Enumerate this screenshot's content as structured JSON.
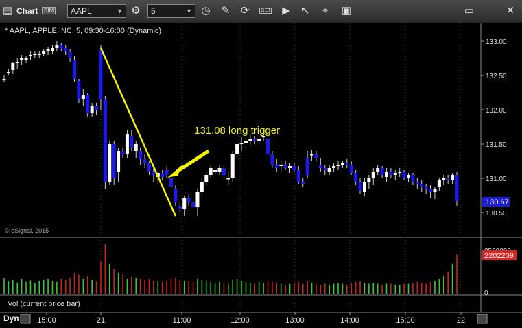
{
  "toolbar": {
    "title": "Chart",
    "sim_badge": "SIM",
    "symbol": "AAPL",
    "interval": "5",
    "icons": [
      "app-logo-icon",
      "sim-icon",
      "symbol-dropdown-icon",
      "refresh-icon",
      "interval-dropdown-icon",
      "clock-icon",
      "draw-pencil-icon",
      "link-icon",
      "get-icon",
      "play-icon",
      "pointer-icon",
      "tool-icon",
      "window-icon",
      "minimize-icon",
      "close-icon"
    ],
    "get_label": "GET"
  },
  "header": "* AAPL, APPLE INC, 5, 09:30-16:00 (Dynamic)",
  "watermark": "© eSignal, 2015",
  "annotation": "131.08 long trigger",
  "vol_label": "Vol (current price bar)",
  "dyn_label": "Dyn",
  "colors": {
    "up": "#ffffff",
    "down": "#1a1aee",
    "trend": "#f5f500",
    "vol_up": "#33cc33",
    "vol_down": "#cc2222",
    "price_badge": "#1c1cdd",
    "vol_badge": "#dd2222"
  },
  "chart_data": {
    "type": "candlestick",
    "price_axis": {
      "ticks": [
        "133.00",
        "132.50",
        "132.00",
        "131.50",
        "131.00",
        "130.50"
      ],
      "ylim": [
        130.35,
        133.2
      ]
    },
    "last_price": "130.67",
    "volume_axis": {
      "ticks": [
        "2500000",
        "0"
      ]
    },
    "last_volume": "2202209",
    "time_axis": {
      "ticks": [
        "15:00",
        "21",
        "11:00",
        "12:00",
        "13:00",
        "14:00",
        "15:00",
        "22"
      ]
    },
    "candles": [
      [
        132.45,
        132.5,
        132.4,
        132.45
      ],
      [
        132.55,
        132.6,
        132.5,
        132.55
      ],
      [
        132.58,
        132.7,
        132.52,
        132.68
      ],
      [
        132.68,
        132.75,
        132.6,
        132.7
      ],
      [
        132.72,
        132.8,
        132.66,
        132.75
      ],
      [
        132.72,
        132.78,
        132.68,
        132.75
      ],
      [
        132.78,
        132.85,
        132.72,
        132.8
      ],
      [
        132.8,
        132.86,
        132.75,
        132.82
      ],
      [
        132.8,
        132.86,
        132.75,
        132.82
      ],
      [
        132.82,
        132.88,
        132.78,
        132.85
      ],
      [
        132.85,
        132.92,
        132.8,
        132.88
      ],
      [
        132.86,
        132.95,
        132.82,
        132.9
      ],
      [
        132.9,
        133.0,
        132.85,
        132.95
      ],
      [
        132.95,
        132.98,
        132.85,
        132.88
      ],
      [
        132.9,
        132.95,
        132.8,
        132.85
      ],
      [
        132.85,
        132.88,
        132.7,
        132.75
      ],
      [
        132.72,
        132.78,
        132.4,
        132.45
      ],
      [
        132.42,
        132.45,
        132.1,
        132.15
      ],
      [
        132.15,
        132.3,
        132.05,
        132.22
      ],
      [
        132.22,
        132.25,
        131.9,
        131.95
      ],
      [
        131.95,
        132.1,
        131.9,
        132.05
      ],
      [
        132.05,
        132.1,
        131.92,
        132.0
      ],
      [
        132.88,
        132.95,
        132.0,
        132.15
      ],
      [
        132.15,
        132.2,
        130.85,
        130.95
      ],
      [
        130.95,
        131.55,
        130.9,
        131.5
      ],
      [
        131.5,
        131.55,
        130.9,
        131.0
      ],
      [
        131.1,
        131.45,
        130.95,
        131.4
      ],
      [
        131.4,
        131.45,
        131.3,
        131.35
      ],
      [
        131.35,
        131.7,
        131.3,
        131.65
      ],
      [
        131.62,
        131.7,
        131.4,
        131.45
      ],
      [
        131.4,
        131.55,
        131.3,
        131.5
      ],
      [
        131.4,
        131.45,
        131.2,
        131.28
      ],
      [
        131.28,
        131.35,
        131.15,
        131.22
      ],
      [
        131.22,
        131.25,
        131.05,
        131.1
      ],
      [
        131.1,
        131.15,
        130.95,
        131.05
      ],
      [
        131.02,
        131.1,
        130.92,
        131.08
      ],
      [
        131.08,
        131.12,
        130.98,
        131.02
      ],
      [
        131.12,
        131.18,
        131.0,
        131.05
      ],
      [
        131.0,
        131.05,
        130.85,
        130.88
      ],
      [
        130.85,
        130.9,
        130.6,
        130.65
      ],
      [
        130.6,
        130.65,
        130.5,
        130.55
      ],
      [
        130.55,
        130.75,
        130.45,
        130.72
      ],
      [
        130.72,
        130.78,
        130.6,
        130.65
      ],
      [
        130.65,
        130.7,
        130.55,
        130.58
      ],
      [
        130.58,
        130.85,
        130.45,
        130.8
      ],
      [
        130.8,
        131.0,
        130.75,
        130.95
      ],
      [
        130.95,
        131.1,
        130.9,
        131.05
      ],
      [
        131.05,
        131.2,
        131.0,
        131.15
      ],
      [
        131.1,
        131.18,
        131.05,
        131.12
      ],
      [
        131.1,
        131.2,
        131.05,
        131.15
      ],
      [
        131.15,
        131.2,
        131.0,
        131.05
      ],
      [
        131.0,
        131.1,
        130.9,
        131.0
      ],
      [
        131.0,
        131.4,
        130.95,
        131.35
      ],
      [
        131.35,
        131.55,
        131.3,
        131.5
      ],
      [
        131.5,
        131.6,
        131.4,
        131.52
      ],
      [
        131.52,
        131.6,
        131.45,
        131.55
      ],
      [
        131.55,
        131.65,
        131.48,
        131.58
      ],
      [
        131.58,
        131.62,
        131.5,
        131.55
      ],
      [
        131.55,
        131.62,
        131.48,
        131.58
      ],
      [
        131.6,
        131.65,
        131.55,
        131.62
      ],
      [
        131.58,
        131.62,
        131.3,
        131.35
      ],
      [
        131.35,
        131.4,
        131.15,
        131.2
      ],
      [
        131.2,
        131.28,
        131.1,
        131.15
      ],
      [
        131.18,
        131.25,
        131.1,
        131.2
      ],
      [
        131.2,
        131.25,
        131.12,
        131.15
      ],
      [
        131.15,
        131.22,
        131.08,
        131.18
      ],
      [
        131.18,
        131.22,
        131.1,
        131.12
      ],
      [
        131.12,
        131.18,
        130.92,
        130.95
      ],
      [
        130.95,
        131.0,
        130.88,
        130.92
      ],
      [
        131.3,
        131.4,
        131.0,
        131.05
      ],
      [
        131.35,
        131.42,
        131.25,
        131.35
      ],
      [
        131.35,
        131.4,
        131.25,
        131.3
      ],
      [
        131.2,
        131.3,
        131.1,
        131.15
      ],
      [
        131.15,
        131.2,
        131.05,
        131.12
      ],
      [
        131.1,
        131.2,
        131.05,
        131.15
      ],
      [
        131.15,
        131.22,
        131.1,
        131.18
      ],
      [
        131.18,
        131.25,
        131.12,
        131.2
      ],
      [
        131.2,
        131.25,
        131.15,
        131.22
      ],
      [
        131.22,
        131.28,
        131.15,
        131.2
      ],
      [
        131.2,
        131.25,
        131.05,
        131.08
      ],
      [
        131.08,
        131.12,
        130.9,
        130.95
      ],
      [
        130.95,
        131.0,
        130.78,
        130.82
      ],
      [
        130.8,
        131.0,
        130.75,
        130.95
      ],
      [
        130.95,
        131.05,
        130.85,
        131.0
      ],
      [
        131.0,
        131.15,
        130.9,
        131.1
      ],
      [
        131.1,
        131.2,
        131.05,
        131.15
      ],
      [
        131.15,
        131.18,
        131.0,
        131.05
      ],
      [
        131.02,
        131.15,
        130.95,
        131.1
      ],
      [
        131.1,
        131.15,
        131.0,
        131.05
      ],
      [
        131.05,
        131.12,
        130.98,
        131.08
      ],
      [
        131.08,
        131.15,
        131.02,
        131.1
      ],
      [
        131.1,
        131.12,
        130.98,
        131.0
      ],
      [
        131.0,
        131.08,
        130.95,
        131.05
      ],
      [
        131.05,
        131.08,
        130.9,
        130.95
      ],
      [
        130.95,
        131.0,
        130.85,
        130.92
      ],
      [
        130.92,
        130.98,
        130.8,
        130.88
      ],
      [
        130.88,
        130.92,
        130.78,
        130.85
      ],
      [
        130.85,
        130.9,
        130.72,
        130.8
      ],
      [
        130.8,
        130.88,
        130.7,
        130.85
      ],
      [
        130.88,
        131.0,
        130.82,
        130.98
      ],
      [
        130.98,
        131.05,
        130.9,
        131.0
      ],
      [
        131.0,
        131.05,
        130.92,
        130.98
      ],
      [
        130.98,
        131.08,
        130.92,
        131.05
      ],
      [
        131.05,
        131.1,
        130.6,
        130.67
      ]
    ],
    "volumes": [
      0.32,
      0.25,
      0.28,
      0.22,
      0.3,
      0.24,
      0.27,
      0.22,
      0.26,
      0.28,
      0.3,
      0.25,
      0.24,
      0.3,
      0.28,
      0.32,
      0.42,
      0.38,
      0.3,
      0.36,
      0.28,
      0.25,
      0.65,
      1.0,
      0.6,
      0.5,
      0.42,
      0.38,
      0.3,
      0.35,
      0.32,
      0.3,
      0.28,
      0.3,
      0.26,
      0.25,
      0.24,
      0.26,
      0.3,
      0.32,
      0.28,
      0.26,
      0.25,
      0.24,
      0.3,
      0.28,
      0.26,
      0.24,
      0.22,
      0.24,
      0.22,
      0.2,
      0.28,
      0.3,
      0.26,
      0.24,
      0.22,
      0.2,
      0.24,
      0.22,
      0.26,
      0.24,
      0.22,
      0.2,
      0.18,
      0.2,
      0.22,
      0.24,
      0.2,
      0.26,
      0.22,
      0.2,
      0.18,
      0.2,
      0.18,
      0.2,
      0.22,
      0.2,
      0.18,
      0.22,
      0.24,
      0.26,
      0.22,
      0.2,
      0.22,
      0.2,
      0.18,
      0.2,
      0.2,
      0.18,
      0.18,
      0.2,
      0.2,
      0.22,
      0.24,
      0.22,
      0.2,
      0.24,
      0.26,
      0.3,
      0.36,
      0.45,
      0.6,
      0.8
    ]
  }
}
